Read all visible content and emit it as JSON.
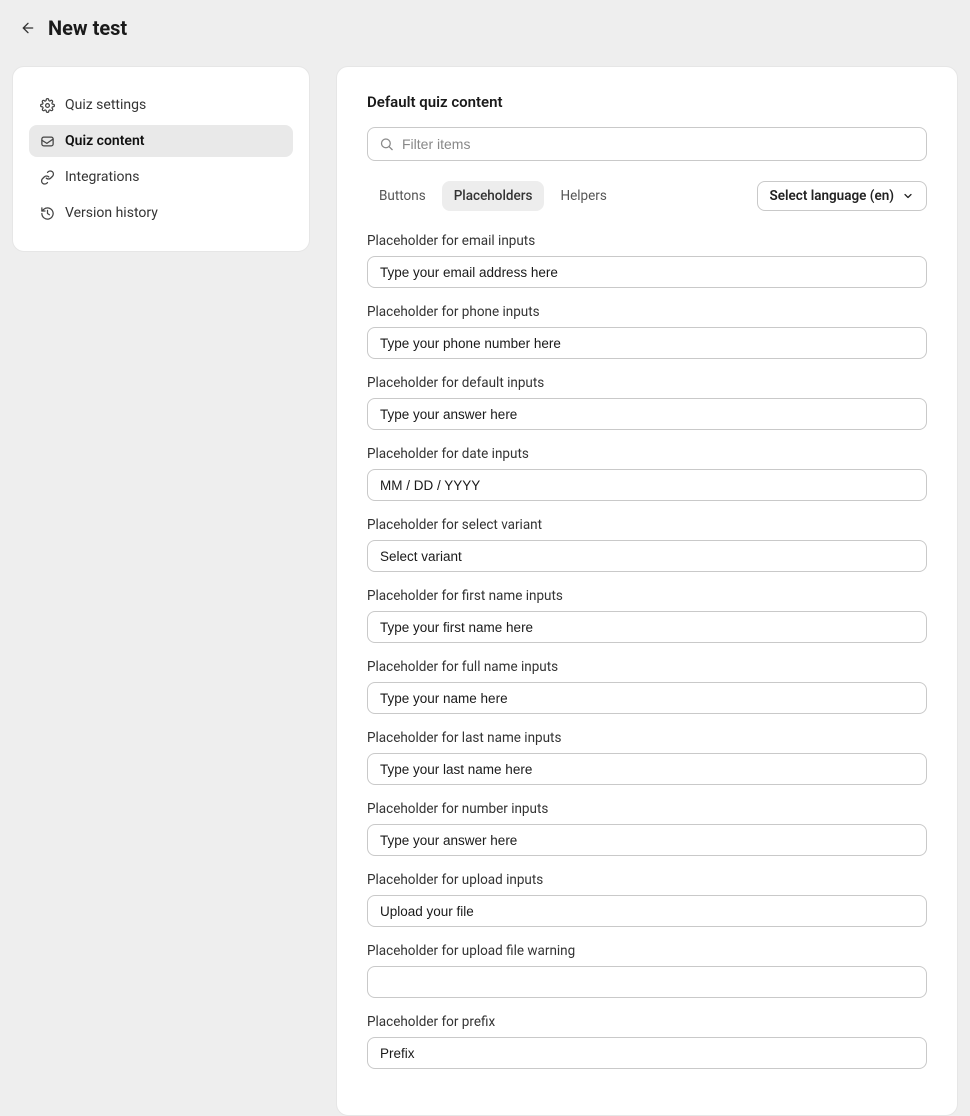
{
  "header": {
    "title": "New test"
  },
  "sidebar": {
    "items": [
      {
        "label": "Quiz settings",
        "icon": "gear-icon",
        "active": false
      },
      {
        "label": "Quiz content",
        "icon": "content-icon",
        "active": true
      },
      {
        "label": "Integrations",
        "icon": "link-icon",
        "active": false
      },
      {
        "label": "Version history",
        "icon": "history-icon",
        "active": false
      }
    ]
  },
  "main": {
    "title": "Default quiz content",
    "filter": {
      "placeholder": "Filter items"
    },
    "tabs": [
      {
        "label": "Buttons",
        "active": false
      },
      {
        "label": "Placeholders",
        "active": true
      },
      {
        "label": "Helpers",
        "active": false
      }
    ],
    "language_select": {
      "label": "Select language (en)"
    },
    "fields": [
      {
        "label": "Placeholder for email inputs",
        "value": "Type your email address here"
      },
      {
        "label": "Placeholder for phone inputs",
        "value": "Type your phone number here"
      },
      {
        "label": "Placeholder for default inputs",
        "value": "Type your answer here"
      },
      {
        "label": "Placeholder for date inputs",
        "value": "MM / DD / YYYY"
      },
      {
        "label": "Placeholder for select variant",
        "value": "Select variant"
      },
      {
        "label": "Placeholder for first name inputs",
        "value": "Type your first name here"
      },
      {
        "label": "Placeholder for full name inputs",
        "value": "Type your name here"
      },
      {
        "label": "Placeholder for last name inputs",
        "value": "Type your last name here"
      },
      {
        "label": "Placeholder for number inputs",
        "value": "Type your answer here"
      },
      {
        "label": "Placeholder for upload inputs",
        "value": "Upload your file"
      },
      {
        "label": "Placeholder for upload file warning",
        "value": ""
      },
      {
        "label": "Placeholder for prefix",
        "value": "Prefix"
      }
    ]
  },
  "icons": {
    "gear-icon": "gear",
    "content-icon": "content",
    "link-icon": "link",
    "history-icon": "history",
    "search-icon": "search",
    "chevron-down-icon": "chevron-down",
    "arrow-left-icon": "arrow-left"
  }
}
